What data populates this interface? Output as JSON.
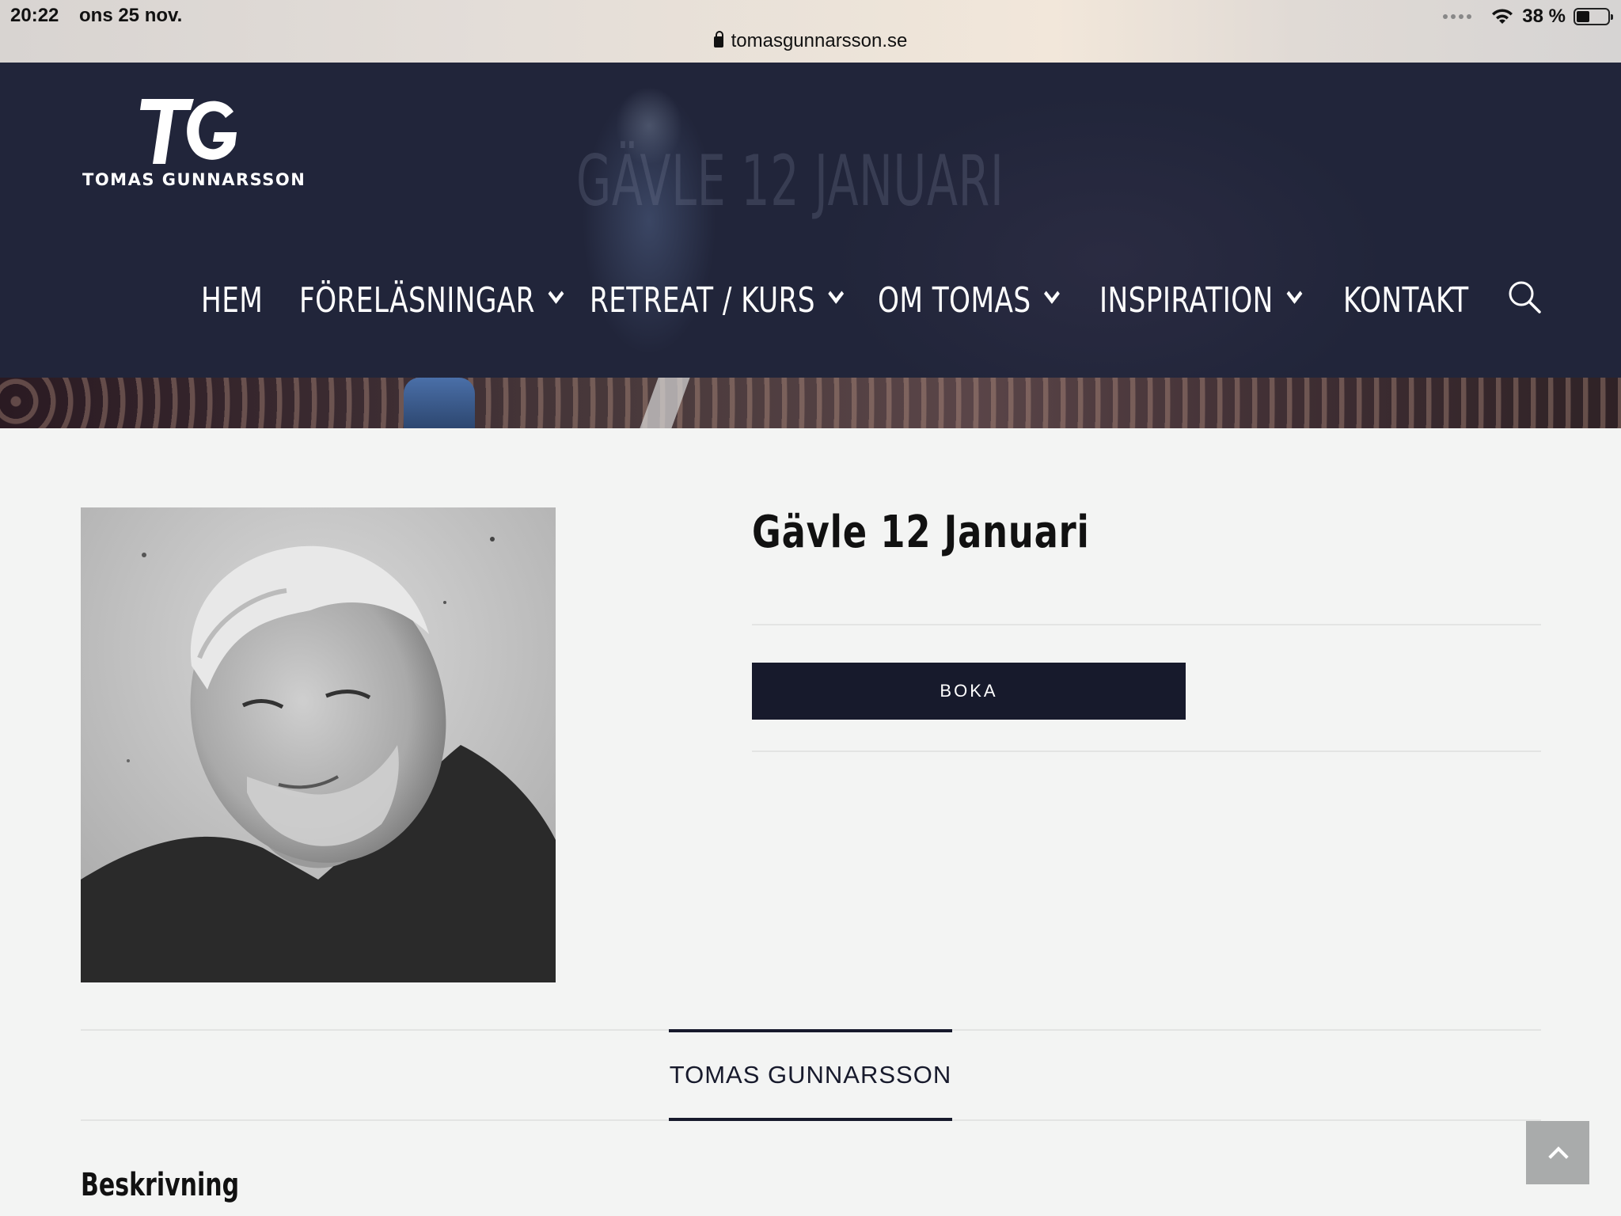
{
  "status_bar": {
    "time": "20:22",
    "date": "ons 25 nov.",
    "battery": "38 %",
    "url": "tomasgunnarsson.se",
    "icons": [
      "signal-dots-icon",
      "wifi-icon",
      "battery-icon",
      "lock-icon"
    ]
  },
  "header": {
    "logo_mark": "TG",
    "logo_text": "TOMAS GUNNARSSON",
    "hero_title": "GÄVLE 12 JANUARI",
    "nav": [
      {
        "label": "HEM"
      },
      {
        "label": "FÖRELÄSNINGAR"
      },
      {
        "label": "RETREAT / KURS"
      },
      {
        "label": "OM TOMAS"
      },
      {
        "label": "INSPIRATION"
      },
      {
        "label": "KONTAKT"
      }
    ],
    "search_icon": "search-icon"
  },
  "product": {
    "title": "Gävle 12 Januari",
    "book_button": "BOKA",
    "image": "portrait-photo"
  },
  "tabs": [
    {
      "label": "TOMAS GUNNARSSON",
      "active": true
    }
  ],
  "description": {
    "heading": "Beskrivning"
  },
  "scroll_top_icon": "chevron-up-icon",
  "colors": {
    "header_bg": "#1f2236",
    "button_bg": "#171a2c",
    "page_bg": "#f3f4f3",
    "scroll_btn": "#a9abab"
  }
}
